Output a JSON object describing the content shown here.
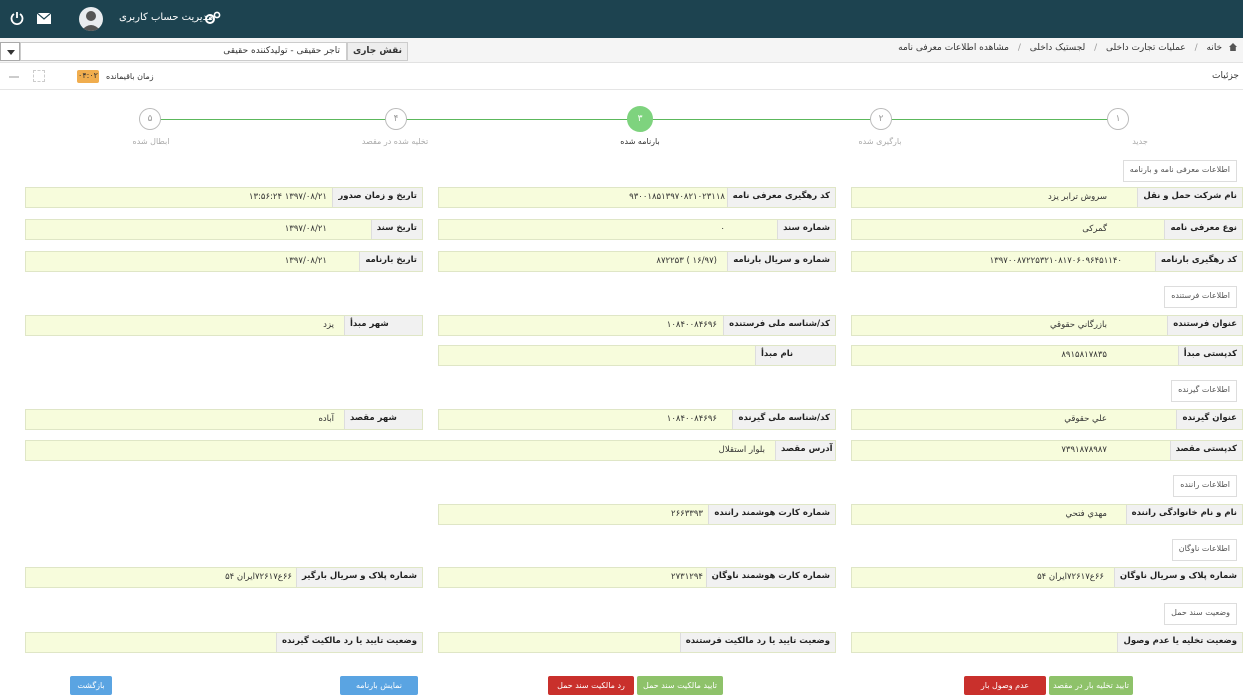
{
  "topbar": {
    "user_label": "مدیریت حساب کاربری",
    "icons": [
      "power-icon",
      "mail-icon",
      "avatar",
      "gears-icon"
    ]
  },
  "role": {
    "label": "نقش جاری",
    "value": "تاجر حقیقی - تولیدکننده حقیقی"
  },
  "breadcrumb": {
    "items": [
      "خانه",
      "عملیات تجارت داخلی",
      "لجستیک داخلی",
      "مشاهده اطلاعات معرفی نامه"
    ]
  },
  "panel": {
    "title": "جزئیات",
    "time_label": "زمان باقیمانده",
    "time_value": "۰۴:۰۲"
  },
  "steps": [
    {
      "num": "۱",
      "label": "جدید",
      "active": false
    },
    {
      "num": "۲",
      "label": "بارگیری شده",
      "active": false
    },
    {
      "num": "۳",
      "label": "بارنامه شده",
      "active": true
    },
    {
      "num": "۴",
      "label": "تخلیه شده در مقصد",
      "active": false
    },
    {
      "num": "۵",
      "label": "ابطال شده",
      "active": false
    }
  ],
  "sections": {
    "intro": "اطلاعات معرفی نامه و بارنامه",
    "sender": "اطلاعات فرستنده",
    "receiver": "اطلاعات گیرنده",
    "driver": "اطلاعات راننده",
    "vehicle": "اطلاعات ناوگان",
    "doc_status": "وضعیت سند حمل"
  },
  "fields": {
    "company": {
      "label": "نام شرکت حمل و نقل",
      "value": "سروش ترابر یزد"
    },
    "tracking_code": {
      "label": "کد رهگیری معرفی نامه",
      "value": "۹۳۰۰۱۸۵۱۳۹۷۰۸۲۱۰۲۳۱۱۸"
    },
    "issue_datetime": {
      "label": "تاریخ و زمان صدور",
      "value": "۱۳۹۷/۰۸/۲۱ ۱۳:۵۶:۲۴"
    },
    "intro_type": {
      "label": "نوع معرفی نامه",
      "value": "گمرکی"
    },
    "doc_number": {
      "label": "شماره سند",
      "value": "۰"
    },
    "doc_date": {
      "label": "تاریخ سند",
      "value": "۱۳۹۷/۰۸/۲۱"
    },
    "waybill_tracking": {
      "label": "کد رهگیری بارنامه",
      "value": "۱۳۹۷۰۰۸۷۲۲۵۳۲۱۰۸۱۷۰۶۰۹۶۴۵۱۱۴۰"
    },
    "waybill_serial": {
      "label": "شماره و سریال بارنامه",
      "value": "(۱۶/۹۷ ) ۸۷۲۲۵۳"
    },
    "waybill_date": {
      "label": "تاریخ بارنامه",
      "value": "۱۳۹۷/۰۸/۲۱"
    },
    "sender_title": {
      "label": "عنوان فرستنده",
      "value": "بازرگاني حقوقي"
    },
    "sender_national": {
      "label": "کد/شناسه ملی فرستنده",
      "value": "۱۰۸۴۰۰۸۴۶۹۶"
    },
    "origin_city": {
      "label": "شهر مبدأ",
      "value": "یزد"
    },
    "origin_postal": {
      "label": "کدپستی مبدأ",
      "value": "۸۹۱۵۸۱۷۸۳۵"
    },
    "origin_name": {
      "label": "نام مبدأ",
      "value": ""
    },
    "receiver_title": {
      "label": "عنوان گیرنده",
      "value": "علي حقوقي"
    },
    "receiver_national": {
      "label": "کد/شناسه ملی گیرنده",
      "value": "۱۰۸۴۰۰۸۴۶۹۶"
    },
    "dest_city": {
      "label": "شهر مقصد",
      "value": "آباده"
    },
    "dest_postal": {
      "label": "کدپستی مقصد",
      "value": "۷۳۹۱۸۷۸۹۸۷"
    },
    "dest_address": {
      "label": "آدرس مقصد",
      "value": "بلوار استقلال"
    },
    "driver_name": {
      "label": "نام و نام خانوادگی راننده",
      "value": "مهدي فتحي"
    },
    "driver_card": {
      "label": "شماره کارت هوشمند راننده",
      "value": "۲۶۶۳۳۹۳"
    },
    "fleet_plate": {
      "label": "شماره پلاک و سریال ناوگان",
      "value": "۶۶ع۷۲۶۱۷ایران ۵۴"
    },
    "fleet_card": {
      "label": "شماره کارت هوشمند ناوگان",
      "value": "۲۷۳۱۲۹۴"
    },
    "loader_plate": {
      "label": "شماره پلاک و سریال بارگیر",
      "value": "۶۶ع۷۲۶۱۷ایران ۵۴"
    },
    "unload_status": {
      "label": "وضعیت تخلیه یا عدم وصول",
      "value": ""
    },
    "sender_owner_status": {
      "label": "وضعیت تایید یا رد مالکیت فرستنده",
      "value": ""
    },
    "receiver_owner_status": {
      "label": "وضعیت تایید یا رد مالکیت گیرنده",
      "value": ""
    }
  },
  "buttons": {
    "back": "بازگشت",
    "show_waybill": "نمایش بارنامه",
    "reject_ownership": "رد مالکیت سند حمل",
    "confirm_ownership": "تایید مالکیت سند حمل",
    "not_received": "عدم وصول بار",
    "confirm_unload": "تایید تخلیه بار در مقصد"
  },
  "colors": {
    "topbar": "#1d4350",
    "field_bg": "#f7fcdc",
    "step_active": "#7ed37e",
    "btn_blue": "#5aa4e2",
    "btn_green": "#8ec26a",
    "btn_red": "#c9302c"
  }
}
